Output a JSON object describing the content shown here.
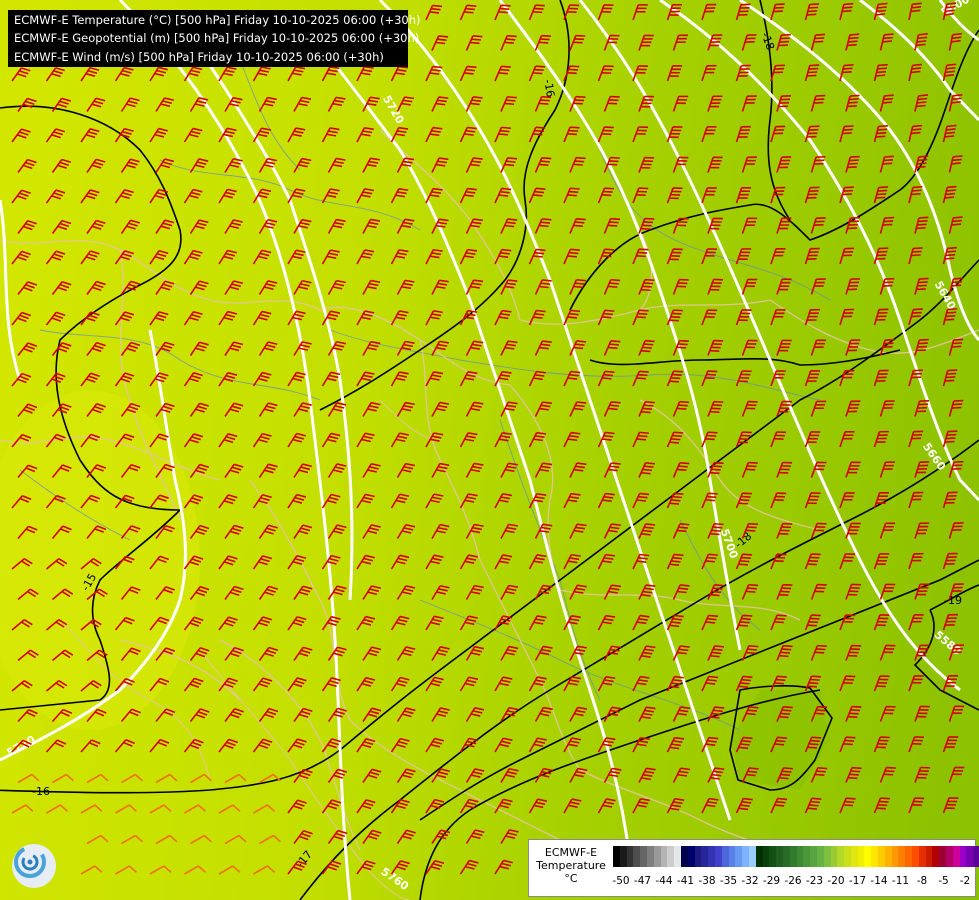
{
  "title_lines": {
    "temperature": "ECMWF-E Temperature (°C) [500 hPa] Friday 10-10-2025 06:00 (+30h)",
    "geopotential": "ECMWF-E Geopotential (m) [500 hPa] Friday 10-10-2025 06:00 (+30h)",
    "wind": "ECMWF-E Wind (m/s) [500 hPa] Friday 10-10-2025 06:00 (+30h)"
  },
  "legend": {
    "line1": "ECMWF-E",
    "line2": "Temperature",
    "unit": "°C",
    "tick_labels": [
      "-50",
      "-47",
      "-44",
      "-41",
      "-38",
      "-35",
      "-32",
      "-29",
      "-26",
      "-23",
      "-20",
      "-17",
      "-14",
      "-11",
      "-8",
      "-5",
      "-2"
    ],
    "colors": [
      "#000000",
      "#1a1a1a",
      "#333333",
      "#4d4d4d",
      "#666666",
      "#7f7f7f",
      "#999999",
      "#b3b3b3",
      "#cccccc",
      "#e6e6e6",
      "#00004d",
      "#00006b",
      "#1a1a80",
      "#262699",
      "#3333b3",
      "#4040cc",
      "#4d66d9",
      "#5980e6",
      "#6699f2",
      "#80b3ff",
      "#99ccff",
      "#003300",
      "#0a4010",
      "#145014",
      "#1e5e1e",
      "#286c28",
      "#327a2d",
      "#3c8833",
      "#4a9638",
      "#58a43e",
      "#66b244",
      "#7fbf3f",
      "#99cc33",
      "#b3d926",
      "#cce01a",
      "#e0e610",
      "#f0f000",
      "#ffff00",
      "#ffe600",
      "#ffcc00",
      "#ffb300",
      "#ff9900",
      "#ff8000",
      "#ff6600",
      "#ff4d00",
      "#e62e00",
      "#cc1a00",
      "#b30000",
      "#990033",
      "#b30066",
      "#cc0099",
      "#9900cc",
      "#7a00b3",
      "#5c0099",
      "#400080"
    ]
  },
  "contour_labels": {
    "geopotential": [
      "5600",
      "5720",
      "5640",
      "5660",
      "5700",
      "5580",
      "5720",
      "5760"
    ],
    "temperature": [
      "-18",
      "-16",
      "-18",
      "-15",
      "-19",
      "-17",
      "-16"
    ]
  },
  "colors": {
    "map_west": "#d6e800",
    "map_east": "#90c400",
    "geopotential_lines": "#ffffff",
    "temperature_lines": "#000000",
    "wind_barbs": "#d40000",
    "wind_barbs_weak": "#f07000",
    "borders": "#e8c4a0",
    "rivers": "#5c87c6"
  },
  "icons": {
    "logo": "weather-logo-icon"
  }
}
